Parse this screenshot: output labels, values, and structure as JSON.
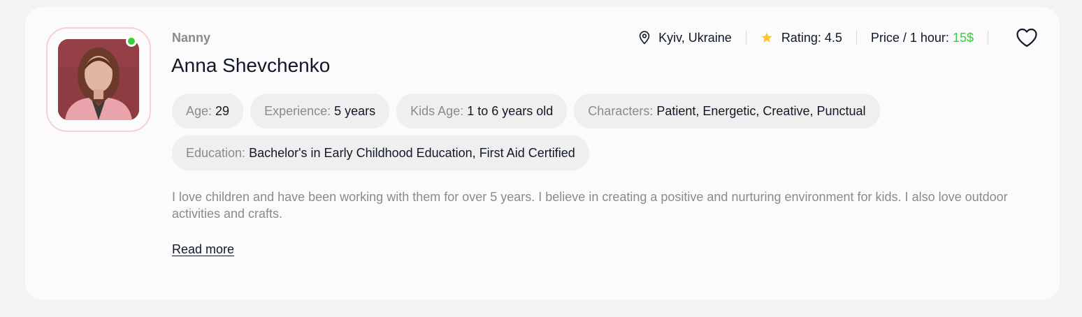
{
  "card": {
    "role": "Nanny",
    "name": "Anna Shevchenko",
    "online": true,
    "status_color": "#38cd3e",
    "meta": {
      "location": "Kyiv, Ukraine",
      "location_icon": "map-pin-icon",
      "rating_label": "Rating: 4.5",
      "rating_icon": "star-icon",
      "price_label": "Price / 1 hour:",
      "price_value": "15$",
      "favorite_icon": "heart-icon"
    },
    "details": [
      {
        "label": "Age:",
        "value": "29"
      },
      {
        "label": "Experience:",
        "value": "5 years"
      },
      {
        "label": "Kids Age:",
        "value": "1 to 6 years old"
      },
      {
        "label": "Characters:",
        "value": "Patient, Energetic, Creative, Punctual"
      },
      {
        "label": "Education:",
        "value": "Bachelor's in Early Childhood Education, First Aid Certified"
      }
    ],
    "about": "I love children and have been working with them for over 5 years. I believe in creating a positive and nurturing environment for kids. I also love outdoor activities and crafts.",
    "read_more": "Read more"
  },
  "colors": {
    "accent_green": "#38cd3e",
    "star_yellow": "#ffc531",
    "avatar_border": "#f6d2cf",
    "muted_text": "#8a8a89",
    "chip_bg": "#efefef"
  }
}
